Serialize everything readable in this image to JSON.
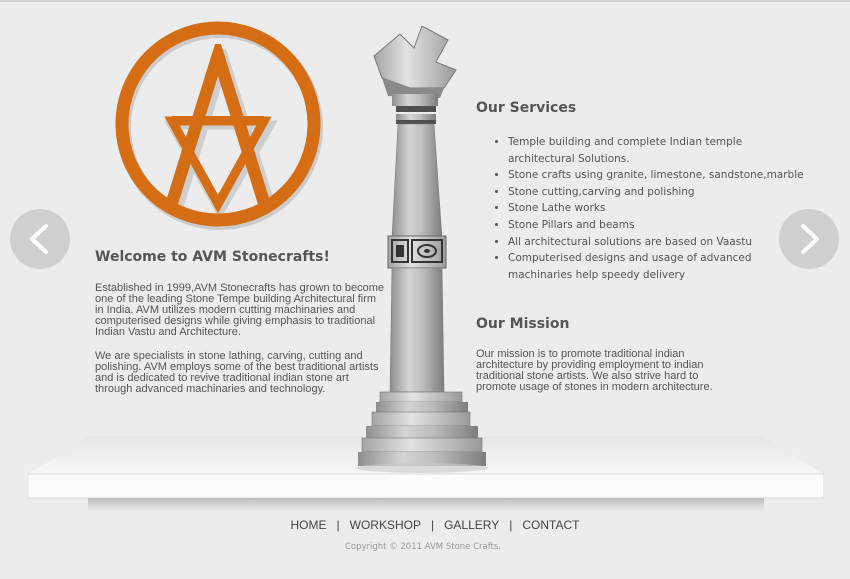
{
  "logo": {
    "name": "AVM Stonecrafts logo",
    "color": "#d56d14"
  },
  "slider": {
    "prev_icon": "chevron-left-icon",
    "next_icon": "chevron-right-icon"
  },
  "welcome": {
    "title": "Welcome to AVM Stonecrafts!",
    "paragraphs": [
      "Established in 1999,AVM Stonecrafts has grown to become one of the leading Stone Tempe building Architectural firm in India. AVM utilizes modern cutting machinaries and computerised designs while giving emphasis to traditional Indian Vastu and Architecture.",
      "We are specialists in stone lathing, carving, cutting and polishing. AVM employs some of the best traditional artists and is dedicated to revive traditional indian stone art through advanced machinaries and technology."
    ]
  },
  "services": {
    "title": "Our Services",
    "items": [
      "Temple building and complete Indian temple architectural Solutions.",
      "Stone crafts using granite, limestone, sandstone,marble",
      "Stone cutting,carving and polishing",
      "Stone Lathe works",
      "Stone Pillars and beams",
      "All architectural solutions are based on Vaastu",
      "Computerised designs and usage of advanced machinaries help speedy delivery"
    ]
  },
  "mission": {
    "title": "Our Mission",
    "text": "Our mission is to promote traditional indian architecture by providing employment to indian traditional stone artists. We also strive hard to promote usage of stones in modern architecture."
  },
  "nav": {
    "items": [
      "HOME",
      "WORKSHOP",
      "GALLERY",
      "CONTACT"
    ],
    "separator": "|"
  },
  "footer": {
    "copyright": "Copyright © 2011 AVM Stone Crafts."
  }
}
